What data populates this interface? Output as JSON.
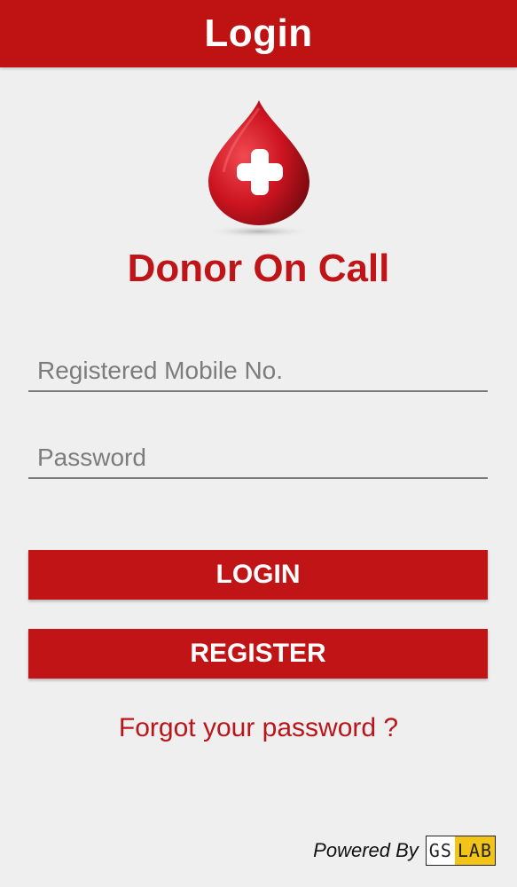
{
  "header": {
    "title": "Login"
  },
  "logo": {
    "icon": "blood-drop-plus-icon",
    "brand_name": "Donor On Call",
    "colors": {
      "drop": "#c8161c",
      "cross": "#ffffff"
    }
  },
  "form": {
    "mobile": {
      "value": "",
      "placeholder": "Registered Mobile No."
    },
    "password": {
      "value": "",
      "placeholder": "Password"
    }
  },
  "buttons": {
    "login_label": "LOGIN",
    "register_label": "REGISTER"
  },
  "links": {
    "forgot_password": "Forgot your password ?"
  },
  "footer": {
    "powered_by": "Powered By",
    "partner_logo": {
      "part1": "GS",
      "part2": "LAB"
    }
  },
  "colors": {
    "primary": "#bf1212",
    "background": "#efefef",
    "text_accent": "#c01518",
    "partner_yellow": "#f2c419"
  }
}
